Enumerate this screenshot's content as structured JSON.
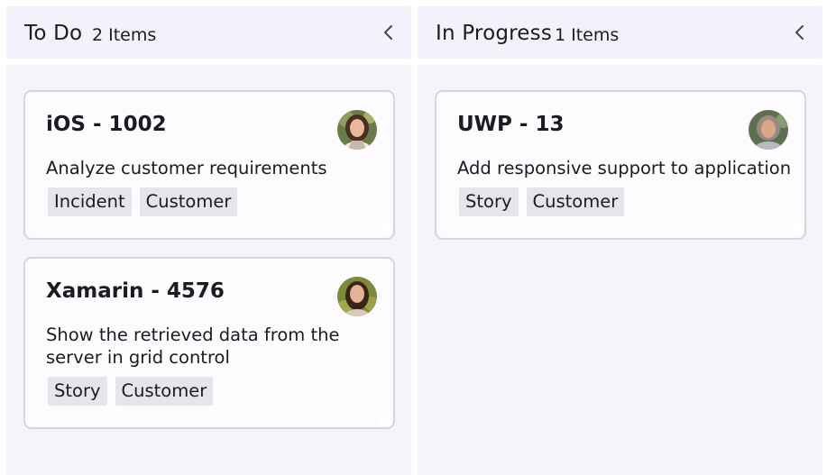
{
  "columns": [
    {
      "title": "To Do",
      "count_label": "2 Items",
      "cards": [
        {
          "title": "iOS - 1002",
          "description": "Analyze customer requirements",
          "tags": [
            "Incident",
            "Customer"
          ],
          "avatar": "woman-avatar-1"
        },
        {
          "title": "Xamarin - 4576",
          "description": "Show the retrieved data from the server in grid control",
          "tags": [
            "Story",
            "Customer"
          ],
          "avatar": "woman-avatar-2"
        }
      ]
    },
    {
      "title": "In Progress",
      "count_label": "1 Items",
      "cards": [
        {
          "title": "UWP - 13",
          "description": "Add responsive support to application",
          "tags": [
            "Story",
            "Customer"
          ],
          "avatar": "woman-avatar-3"
        }
      ]
    }
  ],
  "icons": {
    "collapse": "chevron-left-icon"
  },
  "colors": {
    "header_bg": "#f5f1fb",
    "column_bg": "#f7f3fb",
    "card_bg": "#fefbff",
    "card_border": "#d8d4dc",
    "tag_bg": "#e8e4ec",
    "text": "#1c1b1f"
  }
}
